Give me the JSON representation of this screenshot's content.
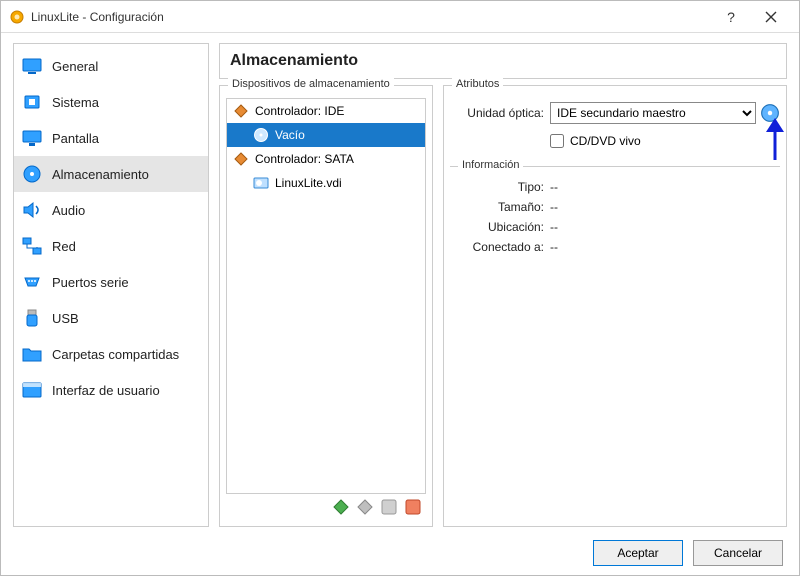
{
  "window": {
    "title": "LinuxLite - Configuración"
  },
  "sidebar": {
    "items": [
      {
        "label": "General"
      },
      {
        "label": "Sistema"
      },
      {
        "label": "Pantalla"
      },
      {
        "label": "Almacenamiento"
      },
      {
        "label": "Audio"
      },
      {
        "label": "Red"
      },
      {
        "label": "Puertos serie"
      },
      {
        "label": "USB"
      },
      {
        "label": "Carpetas compartidas"
      },
      {
        "label": "Interfaz de usuario"
      }
    ],
    "selected_index": 3
  },
  "main": {
    "header": "Almacenamiento",
    "devices_group": "Dispositivos de almacenamiento",
    "attributes_group": "Atributos",
    "info_group": "Información",
    "tree": {
      "controllers": [
        {
          "label": "Controlador: IDE",
          "children": [
            {
              "label": "Vacío",
              "selected": true
            }
          ]
        },
        {
          "label": "Controlador: SATA",
          "children": [
            {
              "label": "LinuxLite.vdi",
              "selected": false
            }
          ]
        }
      ]
    },
    "attributes": {
      "optical_label": "Unidad óptica:",
      "optical_value": "IDE secundario maestro",
      "live_cd_label": "CD/DVD vivo",
      "live_cd_checked": false
    },
    "info": {
      "rows": [
        {
          "label": "Tipo:",
          "value": "--"
        },
        {
          "label": "Tamaño:",
          "value": "--"
        },
        {
          "label": "Ubicación:",
          "value": "--"
        },
        {
          "label": "Conectado a:",
          "value": "--"
        }
      ]
    }
  },
  "footer": {
    "ok": "Aceptar",
    "cancel": "Cancelar"
  }
}
